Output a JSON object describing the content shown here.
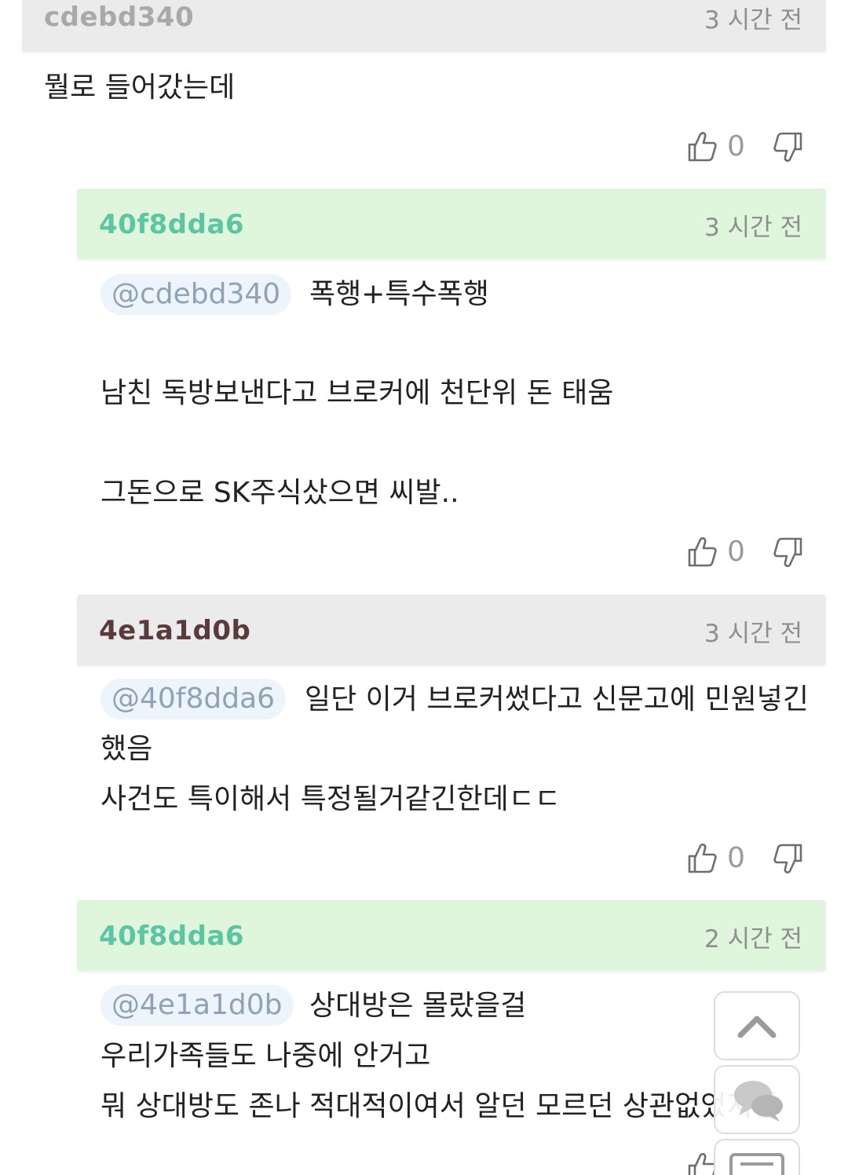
{
  "comments": [
    {
      "user": "cdebd340",
      "time": "3 시간 전",
      "lines": [
        "뭘로 들어갔는데"
      ],
      "likes": "0"
    },
    {
      "user": "40f8dda6",
      "time": "3 시간 전",
      "mention": "@cdebd340",
      "lines": [
        "폭행+특수폭행",
        "남친 독방보낸다고 브로커에 천단위 돈 태움",
        "그돈으로 SK주식샀으면 씨발.."
      ],
      "likes": "0"
    },
    {
      "user": "4e1a1d0b",
      "time": "3 시간 전",
      "mention": "@40f8dda6",
      "lines": [
        "일단 이거 브로커썼다고 신문고에 민원넣긴",
        "했음",
        "사건도 특이해서 특정될거같긴한데ㄷㄷ"
      ],
      "likes": "0"
    },
    {
      "user": "40f8dda6",
      "time": "2 시간 전",
      "mention": "@4e1a1d0b",
      "lines": [
        "상대방은 몰랐을걸",
        "우리가족들도 나중에 안거고",
        "뭐 상대방도 존나 적대적이여서 알던 모르던 상관없었지만"
      ]
    }
  ],
  "colors": {
    "gray_header": "#ebebeb",
    "green_header": "#dff5dc",
    "green_name": "#5cc5a3",
    "brown_name": "#5a3a3a",
    "mention_bg": "#eef4fb",
    "mention_text": "#8fa2b6"
  },
  "icons": {
    "like": "thumbs-up-icon",
    "dislike": "thumbs-down-icon",
    "scroll_top": "chevron-up-icon",
    "comment": "comment-bubble-icon"
  }
}
